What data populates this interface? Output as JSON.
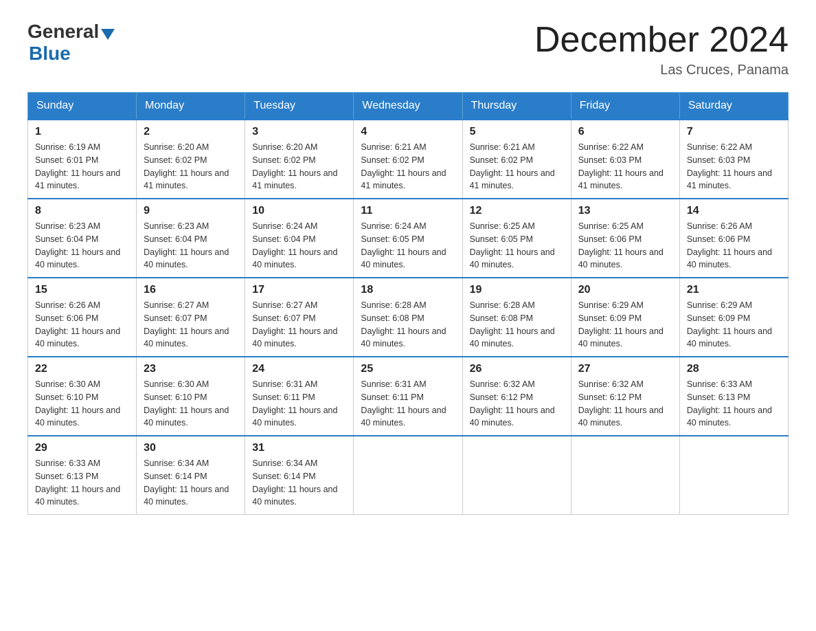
{
  "header": {
    "logo_general": "General",
    "logo_blue": "Blue",
    "month_title": "December 2024",
    "location": "Las Cruces, Panama"
  },
  "days_of_week": [
    "Sunday",
    "Monday",
    "Tuesday",
    "Wednesday",
    "Thursday",
    "Friday",
    "Saturday"
  ],
  "weeks": [
    [
      {
        "num": "1",
        "sunrise": "6:19 AM",
        "sunset": "6:01 PM",
        "daylight": "11 hours and 41 minutes."
      },
      {
        "num": "2",
        "sunrise": "6:20 AM",
        "sunset": "6:02 PM",
        "daylight": "11 hours and 41 minutes."
      },
      {
        "num": "3",
        "sunrise": "6:20 AM",
        "sunset": "6:02 PM",
        "daylight": "11 hours and 41 minutes."
      },
      {
        "num": "4",
        "sunrise": "6:21 AM",
        "sunset": "6:02 PM",
        "daylight": "11 hours and 41 minutes."
      },
      {
        "num": "5",
        "sunrise": "6:21 AM",
        "sunset": "6:02 PM",
        "daylight": "11 hours and 41 minutes."
      },
      {
        "num": "6",
        "sunrise": "6:22 AM",
        "sunset": "6:03 PM",
        "daylight": "11 hours and 41 minutes."
      },
      {
        "num": "7",
        "sunrise": "6:22 AM",
        "sunset": "6:03 PM",
        "daylight": "11 hours and 41 minutes."
      }
    ],
    [
      {
        "num": "8",
        "sunrise": "6:23 AM",
        "sunset": "6:04 PM",
        "daylight": "11 hours and 40 minutes."
      },
      {
        "num": "9",
        "sunrise": "6:23 AM",
        "sunset": "6:04 PM",
        "daylight": "11 hours and 40 minutes."
      },
      {
        "num": "10",
        "sunrise": "6:24 AM",
        "sunset": "6:04 PM",
        "daylight": "11 hours and 40 minutes."
      },
      {
        "num": "11",
        "sunrise": "6:24 AM",
        "sunset": "6:05 PM",
        "daylight": "11 hours and 40 minutes."
      },
      {
        "num": "12",
        "sunrise": "6:25 AM",
        "sunset": "6:05 PM",
        "daylight": "11 hours and 40 minutes."
      },
      {
        "num": "13",
        "sunrise": "6:25 AM",
        "sunset": "6:06 PM",
        "daylight": "11 hours and 40 minutes."
      },
      {
        "num": "14",
        "sunrise": "6:26 AM",
        "sunset": "6:06 PM",
        "daylight": "11 hours and 40 minutes."
      }
    ],
    [
      {
        "num": "15",
        "sunrise": "6:26 AM",
        "sunset": "6:06 PM",
        "daylight": "11 hours and 40 minutes."
      },
      {
        "num": "16",
        "sunrise": "6:27 AM",
        "sunset": "6:07 PM",
        "daylight": "11 hours and 40 minutes."
      },
      {
        "num": "17",
        "sunrise": "6:27 AM",
        "sunset": "6:07 PM",
        "daylight": "11 hours and 40 minutes."
      },
      {
        "num": "18",
        "sunrise": "6:28 AM",
        "sunset": "6:08 PM",
        "daylight": "11 hours and 40 minutes."
      },
      {
        "num": "19",
        "sunrise": "6:28 AM",
        "sunset": "6:08 PM",
        "daylight": "11 hours and 40 minutes."
      },
      {
        "num": "20",
        "sunrise": "6:29 AM",
        "sunset": "6:09 PM",
        "daylight": "11 hours and 40 minutes."
      },
      {
        "num": "21",
        "sunrise": "6:29 AM",
        "sunset": "6:09 PM",
        "daylight": "11 hours and 40 minutes."
      }
    ],
    [
      {
        "num": "22",
        "sunrise": "6:30 AM",
        "sunset": "6:10 PM",
        "daylight": "11 hours and 40 minutes."
      },
      {
        "num": "23",
        "sunrise": "6:30 AM",
        "sunset": "6:10 PM",
        "daylight": "11 hours and 40 minutes."
      },
      {
        "num": "24",
        "sunrise": "6:31 AM",
        "sunset": "6:11 PM",
        "daylight": "11 hours and 40 minutes."
      },
      {
        "num": "25",
        "sunrise": "6:31 AM",
        "sunset": "6:11 PM",
        "daylight": "11 hours and 40 minutes."
      },
      {
        "num": "26",
        "sunrise": "6:32 AM",
        "sunset": "6:12 PM",
        "daylight": "11 hours and 40 minutes."
      },
      {
        "num": "27",
        "sunrise": "6:32 AM",
        "sunset": "6:12 PM",
        "daylight": "11 hours and 40 minutes."
      },
      {
        "num": "28",
        "sunrise": "6:33 AM",
        "sunset": "6:13 PM",
        "daylight": "11 hours and 40 minutes."
      }
    ],
    [
      {
        "num": "29",
        "sunrise": "6:33 AM",
        "sunset": "6:13 PM",
        "daylight": "11 hours and 40 minutes."
      },
      {
        "num": "30",
        "sunrise": "6:34 AM",
        "sunset": "6:14 PM",
        "daylight": "11 hours and 40 minutes."
      },
      {
        "num": "31",
        "sunrise": "6:34 AM",
        "sunset": "6:14 PM",
        "daylight": "11 hours and 40 minutes."
      },
      null,
      null,
      null,
      null
    ]
  ]
}
